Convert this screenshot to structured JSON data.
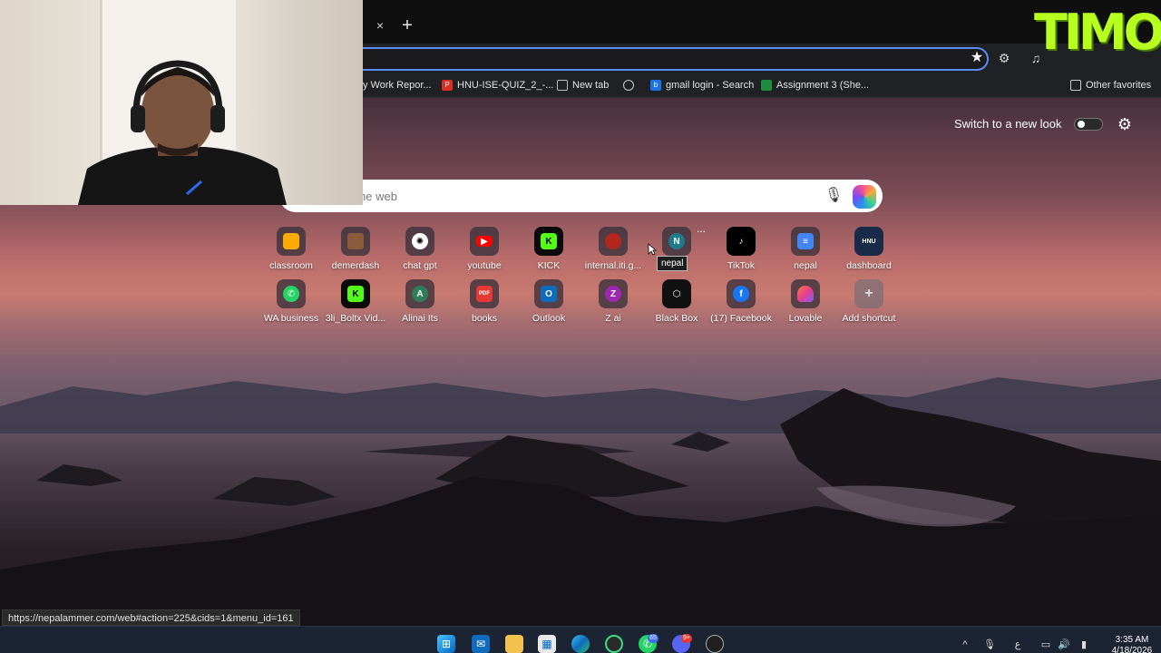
{
  "browser": {
    "tab_close_icon": "×",
    "new_tab_icon": "+",
    "star_icon": "★",
    "bookmarks": [
      {
        "label": "y Work Repor...",
        "icon": "doc-icon",
        "color": "#4a4a4a"
      },
      {
        "label": "HNU-ISE-QUIZ_2_-...",
        "icon": "pdf-icon",
        "color": "#d93025"
      },
      {
        "label": "New tab",
        "icon": "tab-icon",
        "color": "#5f6368"
      },
      {
        "label": "",
        "icon": "openai-icon",
        "color": "#5f6368"
      },
      {
        "label": "gmail login - Search",
        "icon": "bing-icon",
        "color": "#1a73e8"
      },
      {
        "label": "Assignment 3 (She...",
        "icon": "classroom-icon",
        "color": "#1e8e3e"
      }
    ],
    "other_favorites": "Other favorites"
  },
  "ntp": {
    "switch_label": "Switch to a new look",
    "search_placeholder": "he web",
    "tooltip": "nepal",
    "more_dots": "...",
    "shortcuts_row1": [
      {
        "label": "classroom",
        "icon": "classroom-icon",
        "color": "#f9ab00"
      },
      {
        "label": "demerdash",
        "icon": "avatar-icon",
        "color": "#8a5a3a"
      },
      {
        "label": "chat gpt",
        "icon": "openai-icon",
        "color": "#ffffff"
      },
      {
        "label": "youtube",
        "icon": "youtube-icon",
        "color": "#ff0000"
      },
      {
        "label": "KICK",
        "icon": "kick-icon",
        "color": "#53fc18"
      },
      {
        "label": "internal.iti.g...",
        "icon": "iti-icon",
        "color": "#b3261e"
      },
      {
        "label": "nepal",
        "icon": "N",
        "color": "#1f7a8c"
      },
      {
        "label": "TikTok",
        "icon": "tiktok-icon",
        "color": "#000000"
      },
      {
        "label": "nepal",
        "icon": "docs-icon",
        "color": "#4285f4"
      },
      {
        "label": "dashboard",
        "icon": "HNU",
        "color": "#1a2b4a"
      }
    ],
    "shortcuts_row2": [
      {
        "label": "WA business",
        "icon": "whatsapp-icon",
        "color": "#25d366"
      },
      {
        "label": "3li_Boltx Vid...",
        "icon": "kick-icon",
        "color": "#53fc18"
      },
      {
        "label": "Alinai Its",
        "icon": "A",
        "color": "#2e7d5b"
      },
      {
        "label": "books",
        "icon": "pdf-icon",
        "color": "#e53935"
      },
      {
        "label": "Outlook",
        "icon": "outlook-icon",
        "color": "#0f6cbd"
      },
      {
        "label": "Z ai",
        "icon": "Z",
        "color": "#9c27b0"
      },
      {
        "label": "Black Box",
        "icon": "blackbox-icon",
        "color": "#111111"
      },
      {
        "label": "(17) Facebook",
        "icon": "facebook-icon",
        "color": "#1877f2"
      },
      {
        "label": "Lovable",
        "icon": "lovable-icon",
        "color": "#ff5a5f"
      },
      {
        "label": "Add shortcut",
        "icon": "+",
        "color": "#6b6b6b"
      }
    ],
    "status_url": "https://nepalammer.com/web#action=225&cids=1&menu_id=161"
  },
  "taskbar": {
    "apps": [
      "windows-start-icon",
      "mail-icon",
      "file-explorer-icon",
      "store-icon",
      "edge-icon",
      "app-icon",
      "whatsapp-icon",
      "discord-icon",
      "game-icon"
    ],
    "whatsapp_badge": "65",
    "discord_badge": "9+",
    "time": "3:35 AM",
    "date": "4/18/2026"
  },
  "overlay": {
    "watermark": "TIMOO"
  }
}
